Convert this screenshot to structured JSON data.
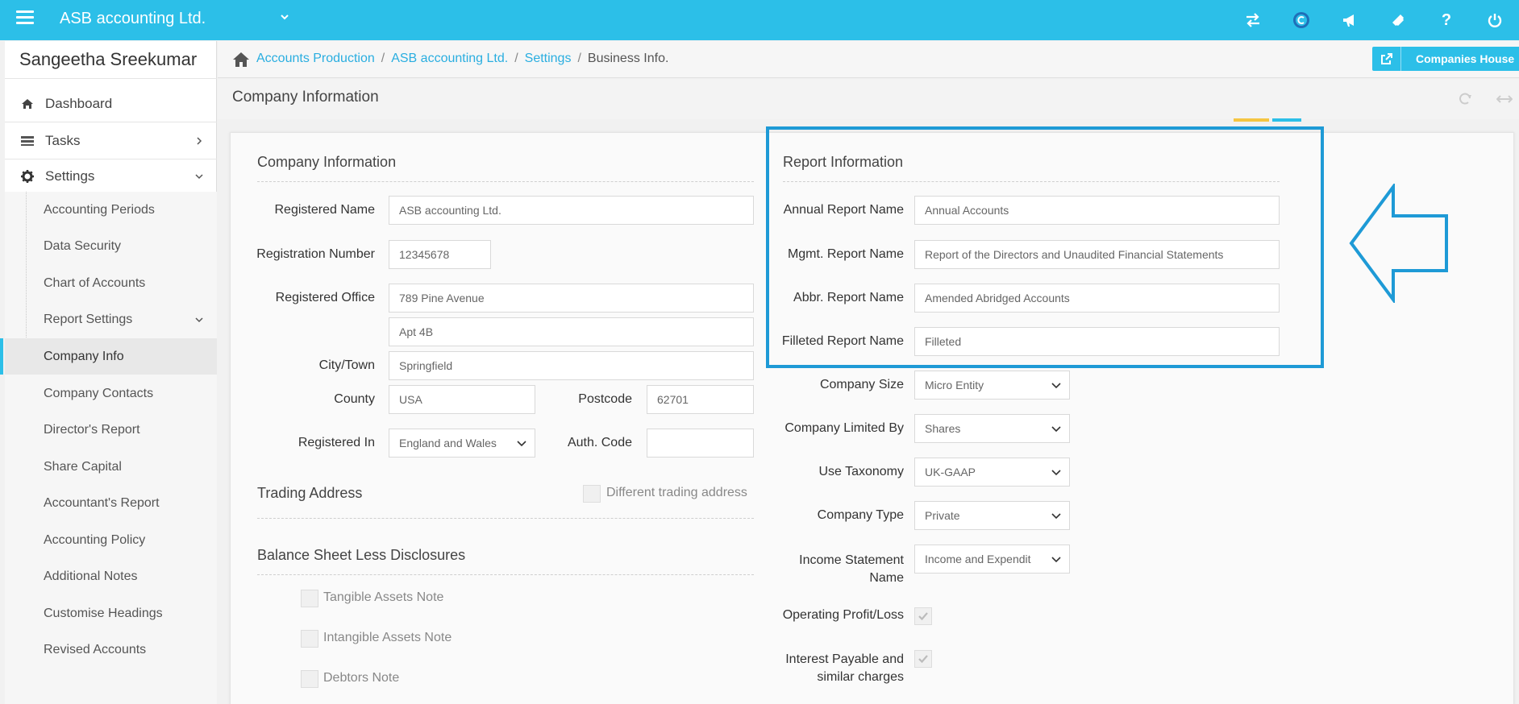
{
  "topbar": {
    "company": "ASB accounting Ltd.",
    "icons": [
      "exchange-icon",
      "logo-c-icon",
      "megaphone-icon",
      "ticket-icon",
      "help-icon",
      "power-icon"
    ],
    "help_glyph": "?"
  },
  "sidebar": {
    "user": "Sangeetha Sreekumar",
    "items": [
      {
        "label": "Dashboard",
        "icon": "home-icon"
      },
      {
        "label": "Tasks",
        "icon": "tasks-icon"
      },
      {
        "label": "Settings",
        "icon": "gear-icon"
      }
    ],
    "sub_items": [
      "Accounting Periods",
      "Data Security",
      "Chart of Accounts",
      "Report Settings",
      "Company Info",
      "Company Contacts",
      "Director's Report",
      "Share Capital",
      "Accountant's Report",
      "Accounting Policy",
      "Additional Notes",
      "Customise Headings",
      "Revised Accounts"
    ]
  },
  "breadcrumb": {
    "items": [
      "Accounts Production",
      "ASB accounting Ltd.",
      "Settings"
    ],
    "current": "Business Info.",
    "sep": "/"
  },
  "companies_house_button": "Companies House",
  "page_title": "Company Information",
  "company_info": {
    "title": "Company Information",
    "registered_name_label": "Registered Name",
    "registered_name": "ASB accounting Ltd.",
    "registration_number_label": "Registration Number",
    "registration_number": "12345678",
    "registered_office_label": "Registered Office",
    "address_line1": "789 Pine Avenue",
    "address_line2": "Apt 4B",
    "city_label": "City/Town",
    "city": "Springfield",
    "county_label": "County",
    "county": "USA",
    "postcode_label": "Postcode",
    "postcode": "62701",
    "registered_in_label": "Registered In",
    "registered_in": "England and Wales",
    "auth_code_label": "Auth. Code",
    "auth_code": ""
  },
  "trading": {
    "title": "Trading Address",
    "different_label": "Different trading address"
  },
  "balance_sheet": {
    "title": "Balance Sheet Less Disclosures",
    "notes": [
      "Tangible Assets Note",
      "Intangible Assets Note",
      "Debtors Note"
    ]
  },
  "report_info": {
    "title": "Report Information",
    "annual_label": "Annual Report Name",
    "annual": "Annual Accounts",
    "mgmt_label": "Mgmt. Report Name",
    "mgmt": "Report of the Directors and Unaudited Financial Statements",
    "abbr_label": "Abbr. Report Name",
    "abbr": "Amended Abridged Accounts",
    "filleted_label": "Filleted Report Name",
    "filleted": "Filleted"
  },
  "company_settings": {
    "size_label": "Company Size",
    "size": "Micro Entity",
    "limited_label": "Company Limited By",
    "limited": "Shares",
    "taxonomy_label": "Use Taxonomy",
    "taxonomy": "UK-GAAP",
    "type_label": "Company Type",
    "type": "Private",
    "income_label_1": "Income Statement",
    "income_label_2": "Name",
    "income": "Income and Expendit",
    "op_profit_label": "Operating Profit/Loss",
    "interest_label_1": "Interest Payable and",
    "interest_label_2": "similar charges"
  },
  "colors": {
    "topbar": "#2cbfe8",
    "link": "#2aaee0",
    "highlight": "#1e9ad6"
  }
}
